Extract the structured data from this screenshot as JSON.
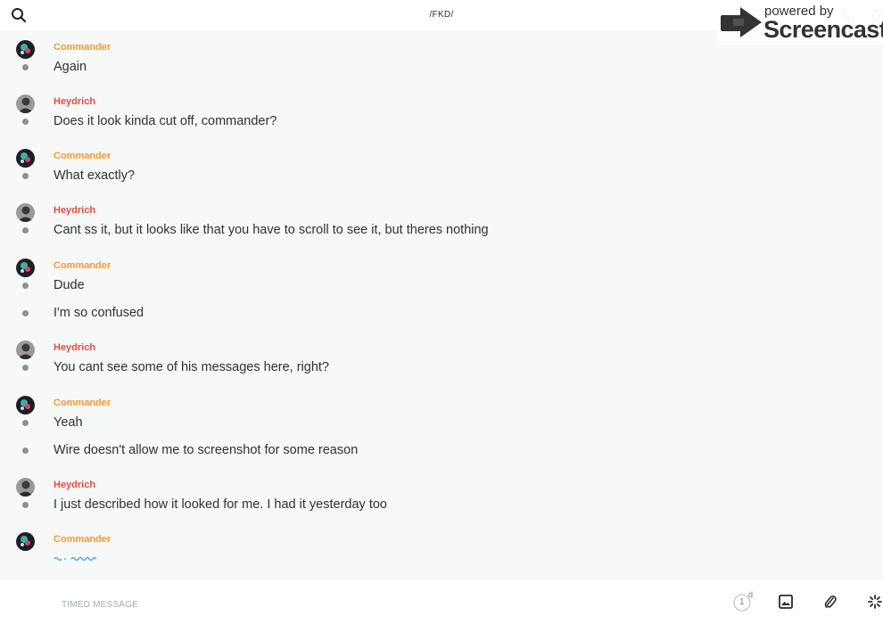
{
  "header": {
    "title": "/FKD/",
    "icons": [
      "search-icon",
      "call-icon",
      "info-icon"
    ]
  },
  "watermark": {
    "powered": "powered by",
    "brand": "Screencastify"
  },
  "messages": [
    {
      "author": "Commander",
      "text": "Again"
    },
    {
      "author": "Heydrich",
      "text": "Does it look kinda cut off, commander?"
    },
    {
      "author": "Commander",
      "text": "What exactly?"
    },
    {
      "author": "Heydrich",
      "text": "Cant ss it, but it looks like that you have to scroll to see it, but theres nothing"
    },
    {
      "author": "Commander",
      "text": "Dude"
    },
    {
      "author": null,
      "text": "I'm so confused"
    },
    {
      "author": "Heydrich",
      "text": "You cant see some of his messages here, right?"
    },
    {
      "author": "Commander",
      "text": "Yeah"
    },
    {
      "author": null,
      "text": "Wire doesn't allow me to screenshot for some reason"
    },
    {
      "author": "Heydrich",
      "text": "I just described how it looked for me. I had it yesterday too"
    },
    {
      "author": "Commander",
      "text": ""
    }
  ],
  "composer": {
    "placeholder": "TIMED MESSAGE",
    "timer_value": "1",
    "timer_unit": "d"
  },
  "colors": {
    "commander": "#f59a32",
    "heydrich": "#e04d45",
    "background": "#f7f8f8"
  }
}
